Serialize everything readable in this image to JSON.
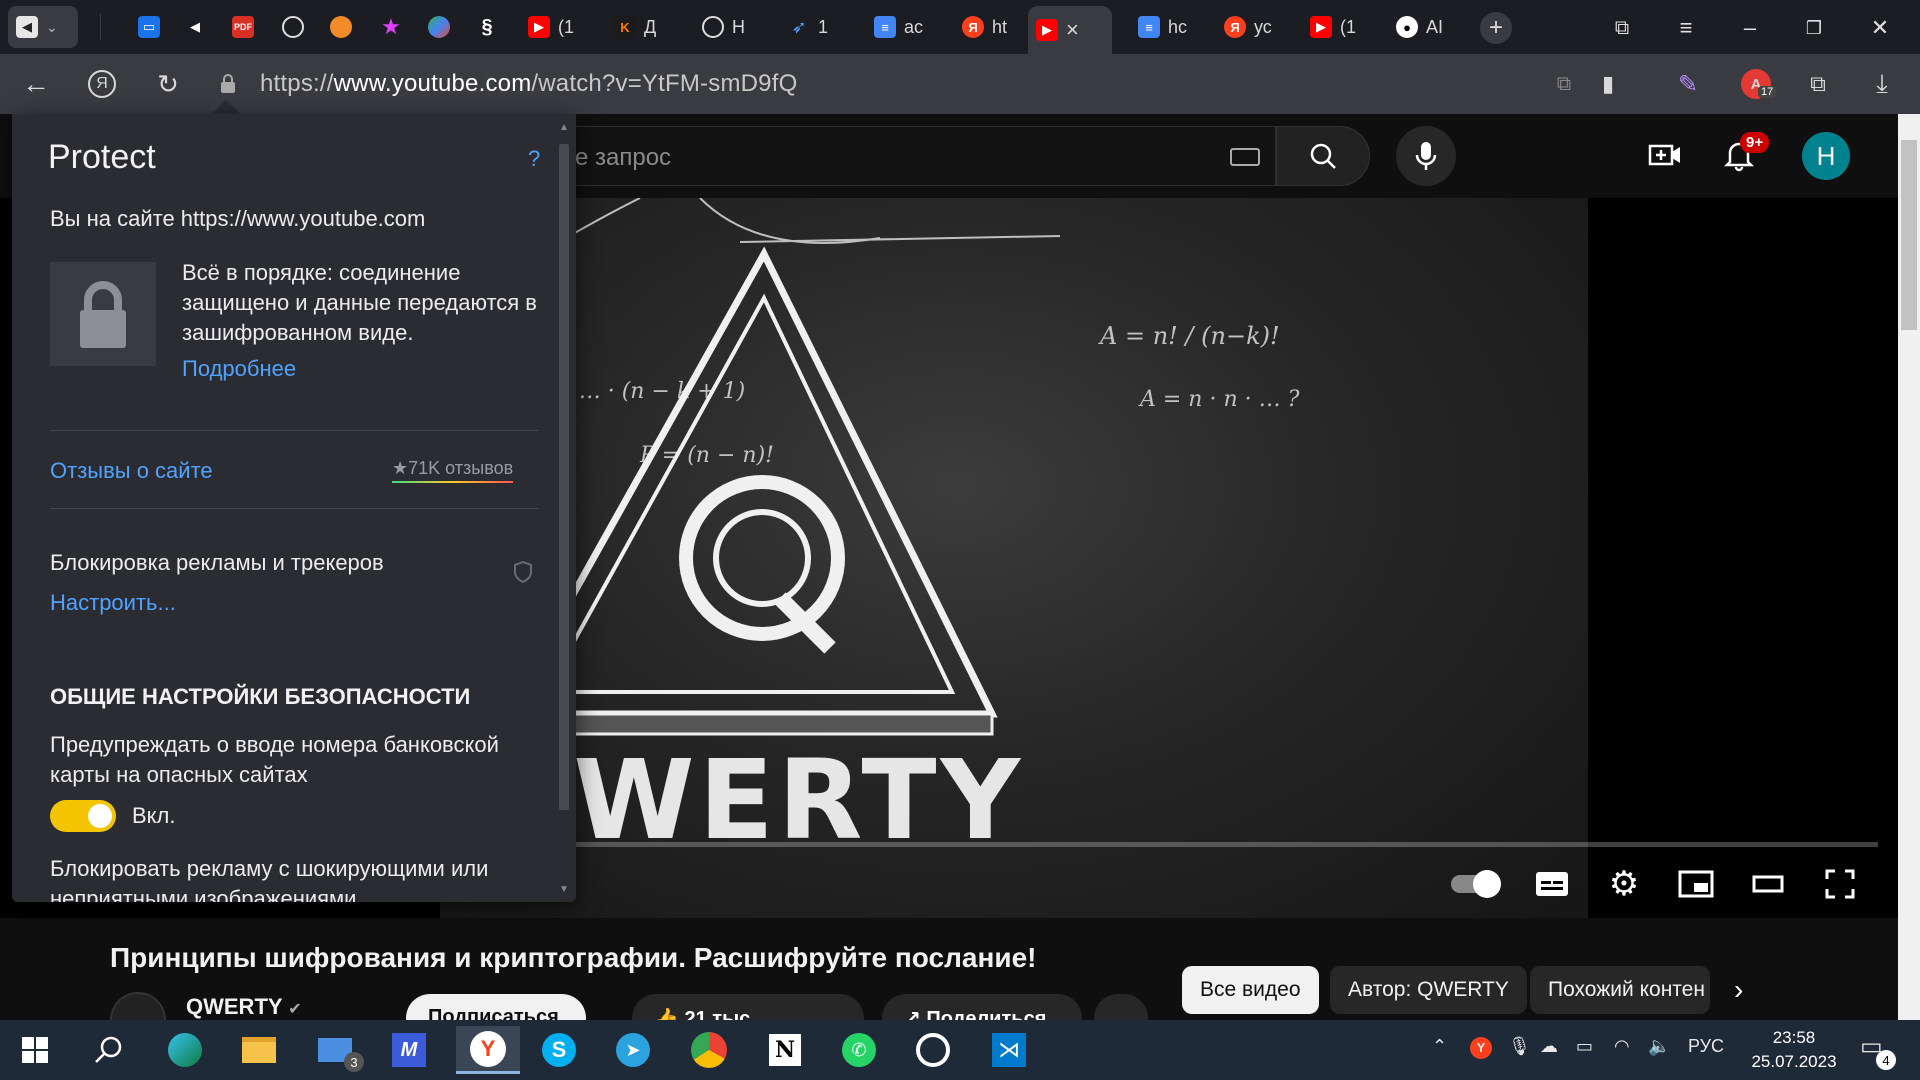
{
  "browser": {
    "tabs": [
      {
        "icon": "speaker-icon",
        "title": ""
      },
      {
        "icon": "chat-icon",
        "title": ""
      },
      {
        "icon": "speaker-icon",
        "title": ""
      },
      {
        "icon": "pdf-icon",
        "title": ""
      },
      {
        "icon": "chatgpt-icon",
        "title": ""
      },
      {
        "icon": "fox-icon",
        "title": ""
      },
      {
        "icon": "star-icon",
        "title": ""
      },
      {
        "icon": "bubbles-icon",
        "title": ""
      },
      {
        "icon": "link-icon",
        "title": ""
      },
      {
        "icon": "youtube-icon",
        "title": "(1"
      },
      {
        "icon": "k-icon",
        "title": "Д"
      },
      {
        "icon": "chatgpt-icon",
        "title": "Н"
      },
      {
        "icon": "wing-icon",
        "title": "1"
      },
      {
        "icon": "doc-icon",
        "title": "ас"
      },
      {
        "icon": "yandex-icon",
        "title": "ht"
      },
      {
        "icon": "youtube-icon",
        "title": "×"
      },
      {
        "icon": "doc-icon",
        "title": "hc"
      },
      {
        "icon": "yandex-icon",
        "title": "ус"
      },
      {
        "icon": "youtube-icon",
        "title": "(1"
      },
      {
        "icon": "github-icon",
        "title": "AI"
      }
    ],
    "url_prefix": "https://",
    "url_host": "www.youtube.com",
    "url_path": "/watch?v=YtFM-smD9fQ",
    "badge_count": "17"
  },
  "youtube": {
    "search_placeholder": "е запрос",
    "notification_badge": "9+",
    "avatar_letter": "Н",
    "video_title": "Принципы шифрования и криптографии. Расшифруйте послание!",
    "channel_name": "QWERTY",
    "subscribe_label": "Подписаться",
    "likes": "21 тыс.",
    "share_label": "Поделиться",
    "chips": [
      "Все видео",
      "Автор: QWERTY",
      "Похожий контен"
    ],
    "thumbnail_text": "QWERTY"
  },
  "protect": {
    "title": "Protect",
    "help": "?",
    "site_line": "Вы на сайте https://www.youtube.com",
    "status_text": "Всё в порядке: соединение защищено и данные передаются в зашифрованном виде.",
    "more_link": "Подробнее",
    "reviews_link": "Отзывы о сайте",
    "reviews_count": "★71K отзывов",
    "ads_block_label": "Блокировка рекламы и трекеров",
    "configure_link": "Настроить...",
    "section_header": "ОБЩИЕ НАСТРОЙКИ БЕЗОПАСНОСТИ",
    "card_warning_text": "Предупреждать о вводе номера банковской карты на опасных сайтах",
    "toggle_state": "Вкл.",
    "shock_ads_text": "Блокировать рекламу с шокирующими или неприятными изображениями"
  },
  "taskbar": {
    "mail_badge": "3",
    "language": "РУС",
    "time": "23:58",
    "date": "25.07.2023",
    "notifications_badge": "4"
  },
  "colors": {
    "accent_link": "#4fa3ff",
    "toggle_on": "#f5c400",
    "youtube_red": "#ff0000",
    "protect_bg": "#2b2c32",
    "taskbar_bg": "#1f2a38"
  }
}
